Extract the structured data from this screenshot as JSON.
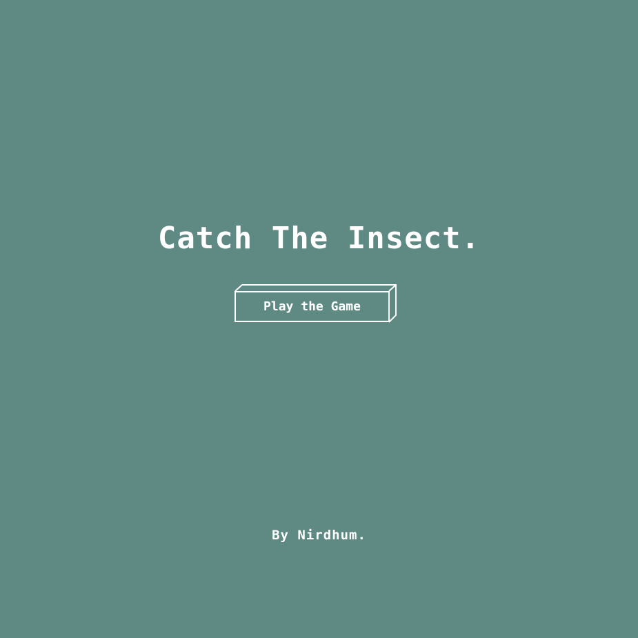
{
  "screen": {
    "title": "Catch The Insect.",
    "play_button_label": "Play the Game",
    "credit": "By Nirdhum."
  },
  "colors": {
    "background": "#5e8a83",
    "foreground": "#ffffff"
  }
}
